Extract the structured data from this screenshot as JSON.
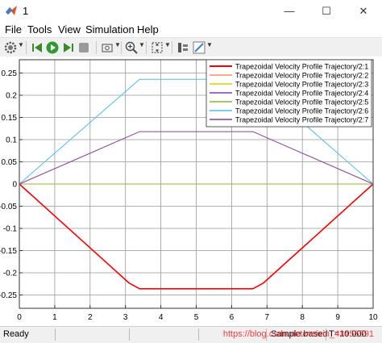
{
  "window": {
    "title": "1",
    "minimize_glyph": "—",
    "maximize_glyph": "☐",
    "close_glyph": "✕"
  },
  "menu": [
    {
      "label": "File"
    },
    {
      "label": "Tools"
    },
    {
      "label": "View"
    },
    {
      "label": "Simulation"
    },
    {
      "label": "Help"
    }
  ],
  "toolbar": {
    "icons": [
      "gear-icon",
      "step-back-icon",
      "run-icon",
      "step-forward-icon",
      "stop-icon",
      "zoom-in-icon",
      "fit-view-icon",
      "cursor-measure-icon",
      "style-icon"
    ]
  },
  "status": {
    "ready": "Ready",
    "sample_mode": "Sample based",
    "time": "T=10.000",
    "watermark": "https://blog.csdn.net/weixin_43456591"
  },
  "chart_data": {
    "type": "line",
    "title": "",
    "xlabel": "",
    "ylabel": "",
    "xlim": [
      0,
      10
    ],
    "ylim": [
      -0.28,
      0.28
    ],
    "x_ticks": [
      "0",
      "1",
      "2",
      "3",
      "4",
      "5",
      "6",
      "7",
      "8",
      "9",
      "10"
    ],
    "y_ticks": [
      "-0.25",
      "-0.2",
      "-0.15",
      "-0.1",
      "-0.05",
      "0",
      "0.05",
      "0.1",
      "0.15",
      "0.2",
      "0.25"
    ],
    "grid": true,
    "legend_position": "top-right",
    "series": [
      {
        "name": "Trapezoidal Velocity Profile Trajectory/2:1",
        "color": "#ff0000",
        "width": 1.6,
        "x": [
          0,
          3.1,
          3.4,
          6.6,
          6.9,
          10
        ],
        "y": [
          0,
          -0.223,
          -0.236,
          -0.236,
          -0.223,
          0
        ]
      },
      {
        "name": "Trapezoidal Velocity Profile Trajectory/2:2",
        "color": "#ff8c66",
        "width": 1,
        "x": [
          0,
          10
        ],
        "y": [
          0,
          0
        ]
      },
      {
        "name": "Trapezoidal Velocity Profile Trajectory/2:3",
        "color": "#f2c200",
        "width": 1,
        "x": [
          0,
          10
        ],
        "y": [
          0,
          0
        ]
      },
      {
        "name": "Trapezoidal Velocity Profile Trajectory/2:4",
        "color": "#7f3fbf",
        "width": 1,
        "x": [
          0,
          10
        ],
        "y": [
          0,
          0
        ]
      },
      {
        "name": "Trapezoidal Velocity Profile Trajectory/2:5",
        "color": "#8cb82a",
        "width": 1,
        "x": [
          0,
          10
        ],
        "y": [
          0,
          0
        ]
      },
      {
        "name": "Trapezoidal Velocity Profile Trajectory/2:6",
        "color": "#4dbeee",
        "width": 1,
        "x": [
          0,
          3.4,
          6.6,
          10
        ],
        "y": [
          0,
          0.236,
          0.236,
          0
        ]
      },
      {
        "name": "Trapezoidal Velocity Profile Trajectory/2:7",
        "color": "#8b3d9a",
        "width": 1,
        "x": [
          0,
          3.4,
          6.6,
          10
        ],
        "y": [
          0,
          0.118,
          0.118,
          0
        ]
      }
    ]
  }
}
